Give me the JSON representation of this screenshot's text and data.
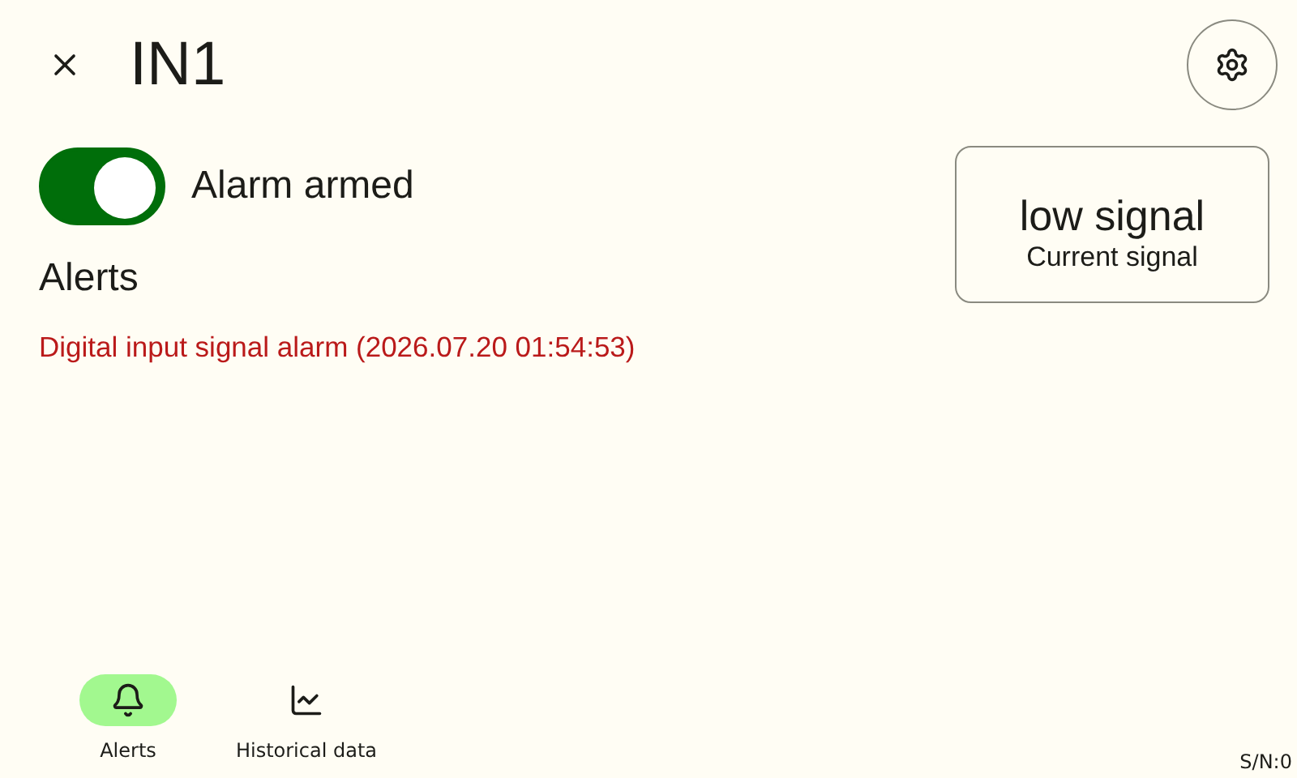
{
  "header": {
    "title": "IN1"
  },
  "alarm_toggle": {
    "label": "Alarm armed",
    "on": true
  },
  "signal_card": {
    "value": "low signal",
    "caption": "Current signal"
  },
  "alerts": {
    "heading": "Alerts",
    "items": [
      "Digital input signal alarm (2026.07.20 01:54:53)"
    ]
  },
  "nav": [
    {
      "label": "Alerts",
      "selected": true
    },
    {
      "label": "Historical data",
      "selected": false
    }
  ],
  "serial": "S/N:0"
}
